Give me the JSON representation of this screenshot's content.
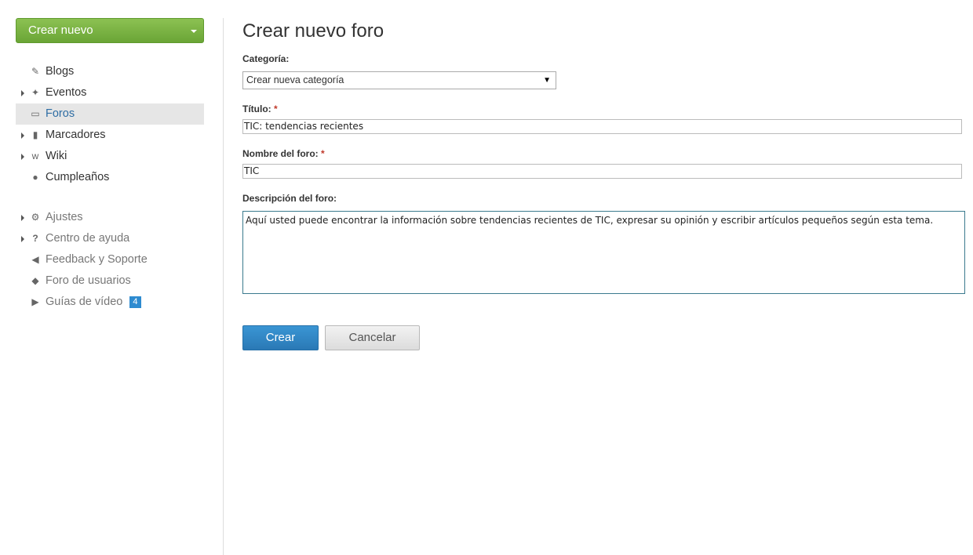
{
  "sidebar": {
    "create_button": "Crear nuevo",
    "items": [
      {
        "label": "Blogs",
        "icon": "edit-icon"
      },
      {
        "label": "Eventos",
        "icon": "pin-icon"
      },
      {
        "label": "Foros",
        "icon": "comment-icon"
      },
      {
        "label": "Marcadores",
        "icon": "bookmark-icon"
      },
      {
        "label": "Wiki",
        "icon": "wikipedia-icon"
      },
      {
        "label": "Cumpleaños",
        "icon": "users-icon"
      }
    ],
    "secondary_items": [
      {
        "label": "Ajustes",
        "icon": "gear-icon"
      },
      {
        "label": "Centro de ayuda",
        "icon": "question-icon"
      },
      {
        "label": "Feedback y Soporte",
        "icon": "megaphone-icon"
      },
      {
        "label": "Foro de usuarios",
        "icon": "chat-bubble-icon"
      },
      {
        "label": "Guías de vídeo",
        "icon": "video-icon",
        "badge": "4"
      }
    ],
    "active_item": "Foros"
  },
  "form": {
    "title": "Crear nuevo foro",
    "category_label": "Categoría:",
    "category_value": "Crear nueva categoría",
    "title_label": "Título:",
    "title_value": "TIC: tendencias recientes",
    "name_label": "Nombre del foro:",
    "name_value": "TIC",
    "description_label": "Descripción del foro:",
    "description_value": "Aquí usted puede encontrar la información sobre tendencias recientes de TIC, expresar su opinión y escribir artículos pequeños según esta tema.",
    "required_mark": "*",
    "submit_label": "Crear",
    "cancel_label": "Cancelar"
  },
  "colors": {
    "primary": "#2a79b5",
    "create_green": "#6aa536",
    "required_red": "#c0392b",
    "badge_blue": "#2e8bd0"
  }
}
